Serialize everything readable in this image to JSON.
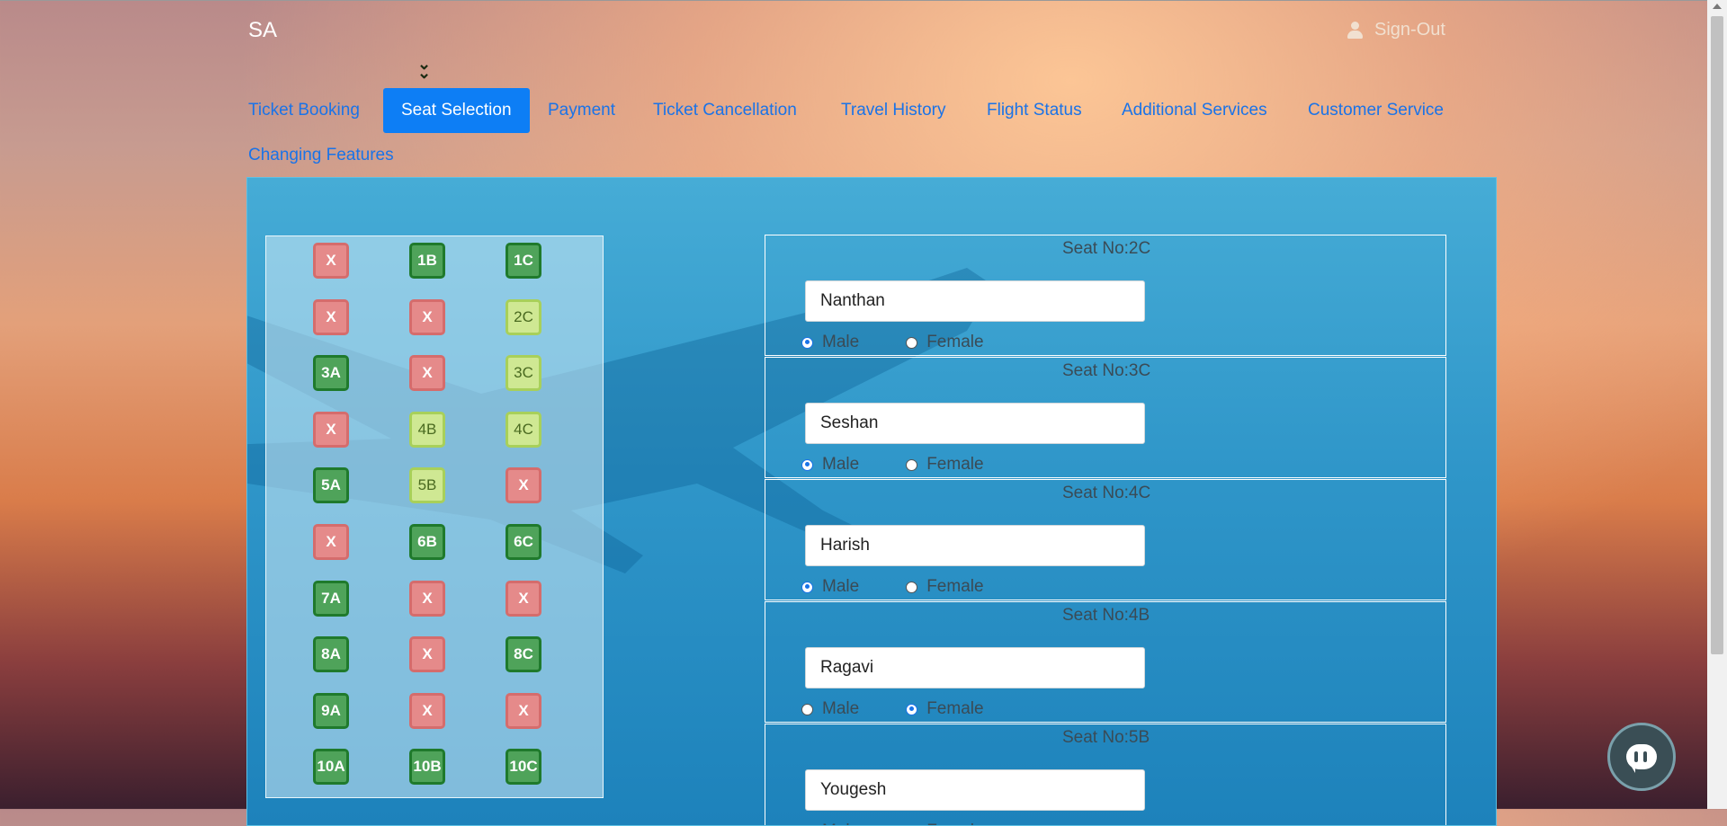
{
  "brand": "SA",
  "signout": {
    "label": "Sign-Out",
    "icon": "user-icon"
  },
  "expand_icon": "double-chevron-down-icon",
  "nav": [
    {
      "label": "Ticket Booking"
    },
    {
      "label": "Seat Selection",
      "active": true
    },
    {
      "label": "Payment"
    },
    {
      "label": "Ticket Cancellation"
    },
    {
      "label": "Travel History"
    },
    {
      "label": "Flight Status"
    },
    {
      "label": "Additional Services"
    },
    {
      "label": "Customer Service"
    },
    {
      "label": "Changing Features"
    }
  ],
  "seats": [
    [
      "X",
      "1B",
      "1C"
    ],
    [
      "X",
      "X",
      "2C"
    ],
    [
      "3A",
      "X",
      "3C"
    ],
    [
      "X",
      "4B",
      "4C"
    ],
    [
      "5A",
      "5B",
      "X"
    ],
    [
      "X",
      "6B",
      "6C"
    ],
    [
      "7A",
      "X",
      "X"
    ],
    [
      "8A",
      "X",
      "8C"
    ],
    [
      "9A",
      "X",
      "X"
    ],
    [
      "10A",
      "10B",
      "10C"
    ]
  ],
  "selected_seats": [
    "2C",
    "3C",
    "4B",
    "4C",
    "5B"
  ],
  "passengers": [
    {
      "seat_label": "Seat No:2C",
      "name": "Nanthan",
      "gender": "Male"
    },
    {
      "seat_label": "Seat No:3C",
      "name": "Seshan",
      "gender": "Male"
    },
    {
      "seat_label": "Seat No:4C",
      "name": "Harish",
      "gender": "Male"
    },
    {
      "seat_label": "Seat No:4B",
      "name": "Ragavi",
      "gender": "Female"
    },
    {
      "seat_label": "Seat No:5B",
      "name": "Yougesh",
      "gender": "Male"
    }
  ],
  "gender_labels": {
    "male": "Male",
    "female": "Female"
  },
  "colors": {
    "booked": "#e58a8a",
    "available": "#4fa35a",
    "selected": "#cfe893",
    "nav_link": "#1a73e8",
    "nav_active": "#0d7ef5"
  },
  "chat_icon": "chat-bubble-icon"
}
